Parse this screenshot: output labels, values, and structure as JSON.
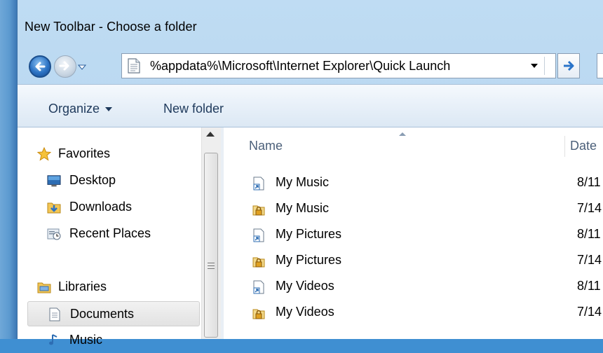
{
  "window": {
    "title": "New Toolbar - Choose a folder"
  },
  "navigation": {
    "back_icon": "back-arrow-icon",
    "forward_icon": "forward-arrow-icon",
    "address": "%appdata%\\Microsoft\\Internet Explorer\\Quick Launch",
    "go_icon": "go-arrow-icon"
  },
  "toolbar": {
    "organize_label": "Organize",
    "new_folder_label": "New folder"
  },
  "nav_pane": {
    "favorites": {
      "label": "Favorites",
      "items": [
        {
          "label": "Desktop",
          "icon": "desktop-icon"
        },
        {
          "label": "Downloads",
          "icon": "downloads-icon"
        },
        {
          "label": "Recent Places",
          "icon": "recent-places-icon"
        }
      ]
    },
    "libraries": {
      "label": "Libraries",
      "items": [
        {
          "label": "Documents",
          "icon": "documents-icon",
          "selected": true
        },
        {
          "label": "Music",
          "icon": "music-icon"
        }
      ]
    }
  },
  "file_list": {
    "columns": {
      "name": "Name",
      "date": "Date"
    },
    "rows": [
      {
        "name": "My Music",
        "date": "8/11",
        "icon": "shortcut-icon"
      },
      {
        "name": "My Music",
        "date": "7/14",
        "icon": "locked-folder-icon"
      },
      {
        "name": "My Pictures",
        "date": "8/11",
        "icon": "shortcut-icon"
      },
      {
        "name": "My Pictures",
        "date": "7/14",
        "icon": "locked-folder-icon"
      },
      {
        "name": "My Videos",
        "date": "8/11",
        "icon": "shortcut-icon"
      },
      {
        "name": "My Videos",
        "date": "7/14",
        "icon": "locked-folder-icon"
      }
    ]
  }
}
